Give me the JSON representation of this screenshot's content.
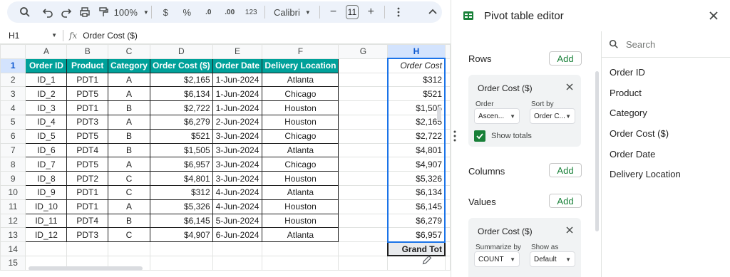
{
  "toolbar": {
    "zoom": "100%",
    "currency": "$",
    "percent": "%",
    "dec_decrease": ".0",
    "dec_increase": ".00",
    "number_format": "123",
    "font": "Calibri",
    "font_size": "11",
    "minus": "−",
    "plus": "+"
  },
  "formula_bar": {
    "cell_ref": "H1",
    "fx": "fx",
    "formula": "Order Cost ($)"
  },
  "sheet": {
    "columns": [
      "A",
      "B",
      "C",
      "D",
      "E",
      "F",
      "G",
      "H"
    ],
    "row_numbers": [
      "1",
      "2",
      "3",
      "4",
      "5",
      "6",
      "7",
      "8",
      "9",
      "10",
      "11",
      "12",
      "13",
      "14",
      "15"
    ],
    "headers": [
      "Order ID",
      "Product",
      "Category",
      "Order Cost ($)",
      "Order Date",
      "Delivery Location"
    ],
    "rows": [
      [
        "ID_1",
        "PDT1",
        "A",
        "$2,165",
        "1-Jun-2024",
        "Atlanta"
      ],
      [
        "ID_2",
        "PDT5",
        "A",
        "$6,134",
        "1-Jun-2024",
        "Chicago"
      ],
      [
        "ID_3",
        "PDT1",
        "B",
        "$2,722",
        "1-Jun-2024",
        "Houston"
      ],
      [
        "ID_4",
        "PDT3",
        "A",
        "$6,279",
        "2-Jun-2024",
        "Houston"
      ],
      [
        "ID_5",
        "PDT5",
        "B",
        "$521",
        "3-Jun-2024",
        "Chicago"
      ],
      [
        "ID_6",
        "PDT4",
        "B",
        "$1,505",
        "3-Jun-2024",
        "Atlanta"
      ],
      [
        "ID_7",
        "PDT5",
        "A",
        "$6,957",
        "3-Jun-2024",
        "Chicago"
      ],
      [
        "ID_8",
        "PDT2",
        "C",
        "$4,801",
        "3-Jun-2024",
        "Houston"
      ],
      [
        "ID_9",
        "PDT1",
        "C",
        "$312",
        "4-Jun-2024",
        "Atlanta"
      ],
      [
        "ID_10",
        "PDT1",
        "A",
        "$5,326",
        "4-Jun-2024",
        "Houston"
      ],
      [
        "ID_11",
        "PDT4",
        "B",
        "$6,145",
        "5-Jun-2024",
        "Houston"
      ],
      [
        "ID_12",
        "PDT3",
        "C",
        "$4,907",
        "6-Jun-2024",
        "Atlanta"
      ]
    ],
    "pivot": {
      "header": "Order Cost",
      "values": [
        "$312",
        "$521",
        "$1,505",
        "$2,165",
        "$2,722",
        "$4,801",
        "$4,907",
        "$5,326",
        "$6,134",
        "$6,145",
        "$6,279",
        "$6,957"
      ],
      "total_label": "Grand Tot"
    }
  },
  "editor": {
    "title": "Pivot table editor",
    "rows_label": "Rows",
    "columns_label": "Columns",
    "values_label": "Values",
    "add_label": "Add",
    "rows_card": {
      "title": "Order Cost ($)",
      "order_label": "Order",
      "order_value": "Ascen...",
      "sort_label": "Sort by",
      "sort_value": "Order C...",
      "show_totals": "Show totals"
    },
    "values_card": {
      "title": "Order Cost ($)",
      "summarize_label": "Summarize by",
      "summarize_value": "COUNT",
      "show_as_label": "Show as",
      "show_as_value": "Default"
    },
    "search_placeholder": "Search",
    "fields": [
      "Order ID",
      "Product",
      "Category",
      "Order Cost ($)",
      "Order Date",
      "Delivery Location"
    ]
  }
}
